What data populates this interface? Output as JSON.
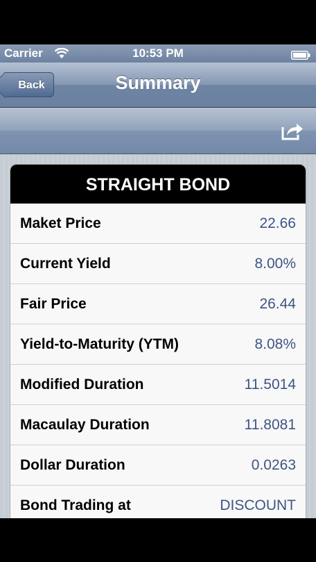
{
  "status": {
    "carrier": "Carrier",
    "time": "10:53 PM"
  },
  "nav": {
    "back_label": "Back",
    "title": "Summary"
  },
  "icons": {
    "share": "share-icon",
    "wifi": "wifi-icon",
    "battery": "battery-icon"
  },
  "card": {
    "title": "STRAIGHT BOND",
    "rows": [
      {
        "label": "Maket Price",
        "value": "22.66"
      },
      {
        "label": "Current Yield",
        "value": "8.00%"
      },
      {
        "label": "Fair Price",
        "value": "26.44"
      },
      {
        "label": "Yield-to-Maturity (YTM)",
        "value": "8.08%"
      },
      {
        "label": "Modified Duration",
        "value": "11.5014"
      },
      {
        "label": "Macaulay Duration",
        "value": "11.8081"
      },
      {
        "label": "Dollar Duration",
        "value": "0.0263"
      },
      {
        "label": "Bond Trading at",
        "value": "DISCOUNT"
      }
    ]
  },
  "colors": {
    "value_text": "#3d5585",
    "header_bg": "#000000",
    "nav_bar": "#6e84a3"
  }
}
